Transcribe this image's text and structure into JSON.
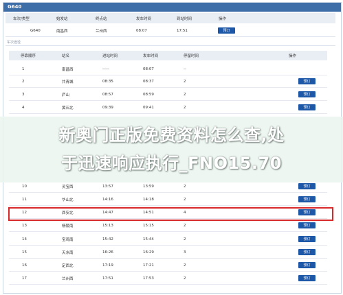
{
  "window_title": "G640",
  "summary": {
    "headers": [
      "车次/类型",
      "始发站",
      "终点站",
      "发车时间",
      "到站时间",
      "操作"
    ],
    "row": {
      "train": "G640",
      "from": "南昌西",
      "to": "兰州西",
      "depart": "08:07",
      "arrive": "17:51",
      "button": "预订"
    }
  },
  "section_title": "车次途径",
  "stops": {
    "headers": [
      "停靠顺序",
      "站名",
      "进站时间",
      "发车时间",
      "停留时间",
      "操作"
    ],
    "button_label": "预订",
    "rows": [
      {
        "seq": "1",
        "station": "南昌西",
        "arr": "-----",
        "dep": "08:07",
        "stay": "--",
        "button": false
      },
      {
        "seq": "2",
        "station": "共青城",
        "arr": "08:35",
        "dep": "08:37",
        "stay": "2",
        "button": true
      },
      {
        "seq": "3",
        "station": "庐山",
        "arr": "08:57",
        "dep": "08:59",
        "stay": "2",
        "button": true
      },
      {
        "seq": "4",
        "station": "黄石北",
        "arr": "09:39",
        "dep": "09:41",
        "stay": "2",
        "button": true
      },
      {
        "seq": "10",
        "station": "灵宝西",
        "arr": "13:57",
        "dep": "13:59",
        "stay": "2",
        "button": true
      },
      {
        "seq": "11",
        "station": "华山北",
        "arr": "14:16",
        "dep": "14:18",
        "stay": "2",
        "button": true
      },
      {
        "seq": "12",
        "station": "西安北",
        "arr": "14:47",
        "dep": "14:51",
        "stay": "4",
        "button": true
      },
      {
        "seq": "13",
        "station": "杨陵南",
        "arr": "15:13",
        "dep": "15:15",
        "stay": "2",
        "button": true
      },
      {
        "seq": "14",
        "station": "宝鸡南",
        "arr": "15:42",
        "dep": "15:44",
        "stay": "2",
        "button": true
      },
      {
        "seq": "15",
        "station": "天水南",
        "arr": "16:26",
        "dep": "16:29",
        "stay": "3",
        "button": true
      },
      {
        "seq": "16",
        "station": "定西北",
        "arr": "17:19",
        "dep": "17:21",
        "stay": "2",
        "button": true
      },
      {
        "seq": "17",
        "station": "兰州西",
        "arr": "17:51",
        "dep": "17:53",
        "stay": "2",
        "button": true
      }
    ]
  },
  "banner": {
    "line1": "新奥门正版免费资料怎么查,处",
    "line2": "于迅速响应执行_FNO15.70"
  },
  "colors": {
    "title_bar": "#3e6ea8",
    "button": "#1d57a8",
    "highlight": "#d9282a"
  }
}
